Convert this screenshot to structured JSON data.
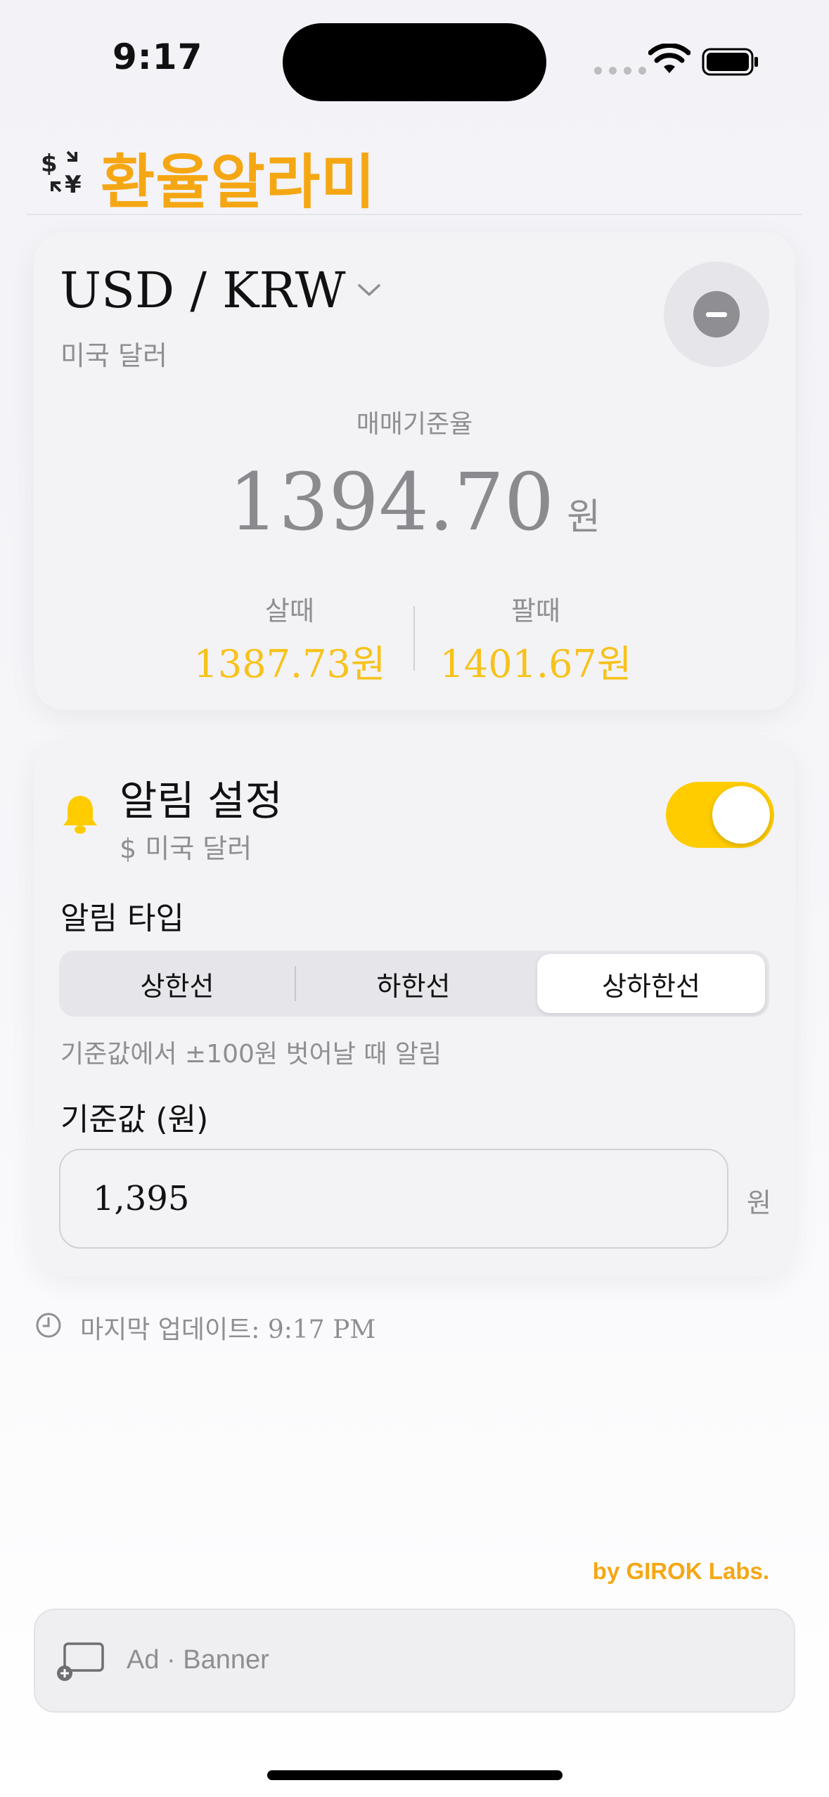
{
  "status_bar": {
    "time": "9:17",
    "icons": [
      "signal-icon",
      "wifi-icon",
      "battery-icon"
    ]
  },
  "header": {
    "title": "환율알라미",
    "logo_icon": "currency-exchange-icon",
    "title_color": "#f5a713"
  },
  "rate_card": {
    "pair": "USD / KRW",
    "currency_name": "미국 달러",
    "rate_label": "매매기준율",
    "rate_value": "1394.70",
    "rate_unit": "원",
    "buy_label": "살때",
    "buy_value": "1387.73원",
    "sell_label": "팔때",
    "sell_value": "1401.67원",
    "accent_color": "#f7c21b"
  },
  "alert_card": {
    "title": "알림 설정",
    "subtitle": "$ 미국 달러",
    "enabled": true,
    "toggle_color": "#ffcc00",
    "type_label": "알림 타입",
    "segments": [
      "상한선",
      "하한선",
      "상하한선"
    ],
    "selected_segment": "상하한선",
    "hint": "기준값에서 ±100원 벗어날 때 알림",
    "base_label": "기준값 (원)",
    "base_value": "1,395",
    "base_unit": "원"
  },
  "footer": {
    "last_update": "마지막 업데이트: 9:17 PM",
    "credit": "by GIROK Labs.",
    "ad_text": "Ad · Banner"
  }
}
